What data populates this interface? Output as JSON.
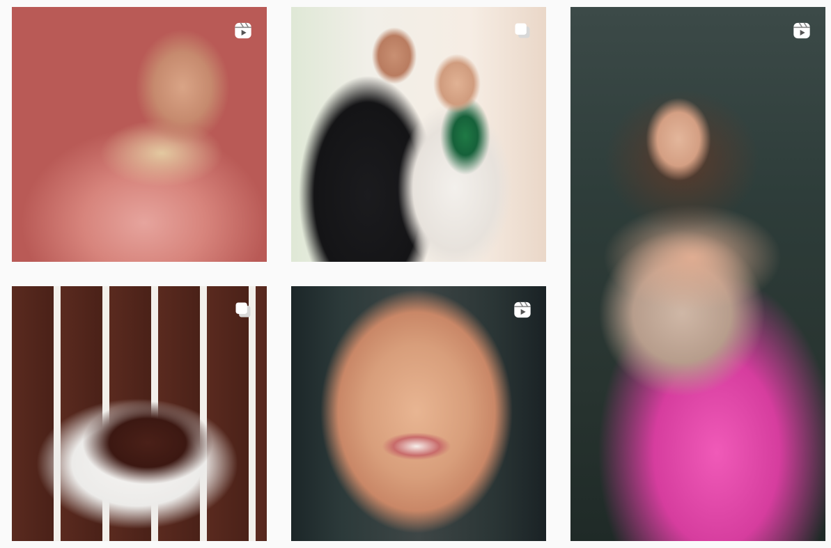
{
  "grid": {
    "posts": [
      {
        "type": "reel",
        "badge_icon": "reel-icon"
      },
      {
        "type": "carousel",
        "badge_icon": "carousel-icon"
      },
      {
        "type": "reel",
        "badge_icon": "reel-icon"
      },
      {
        "type": "carousel",
        "badge_icon": "carousel-icon"
      },
      {
        "type": "reel",
        "badge_icon": "reel-icon"
      }
    ]
  },
  "colors": {
    "background": "#fafafa",
    "badge": "#ffffff"
  }
}
